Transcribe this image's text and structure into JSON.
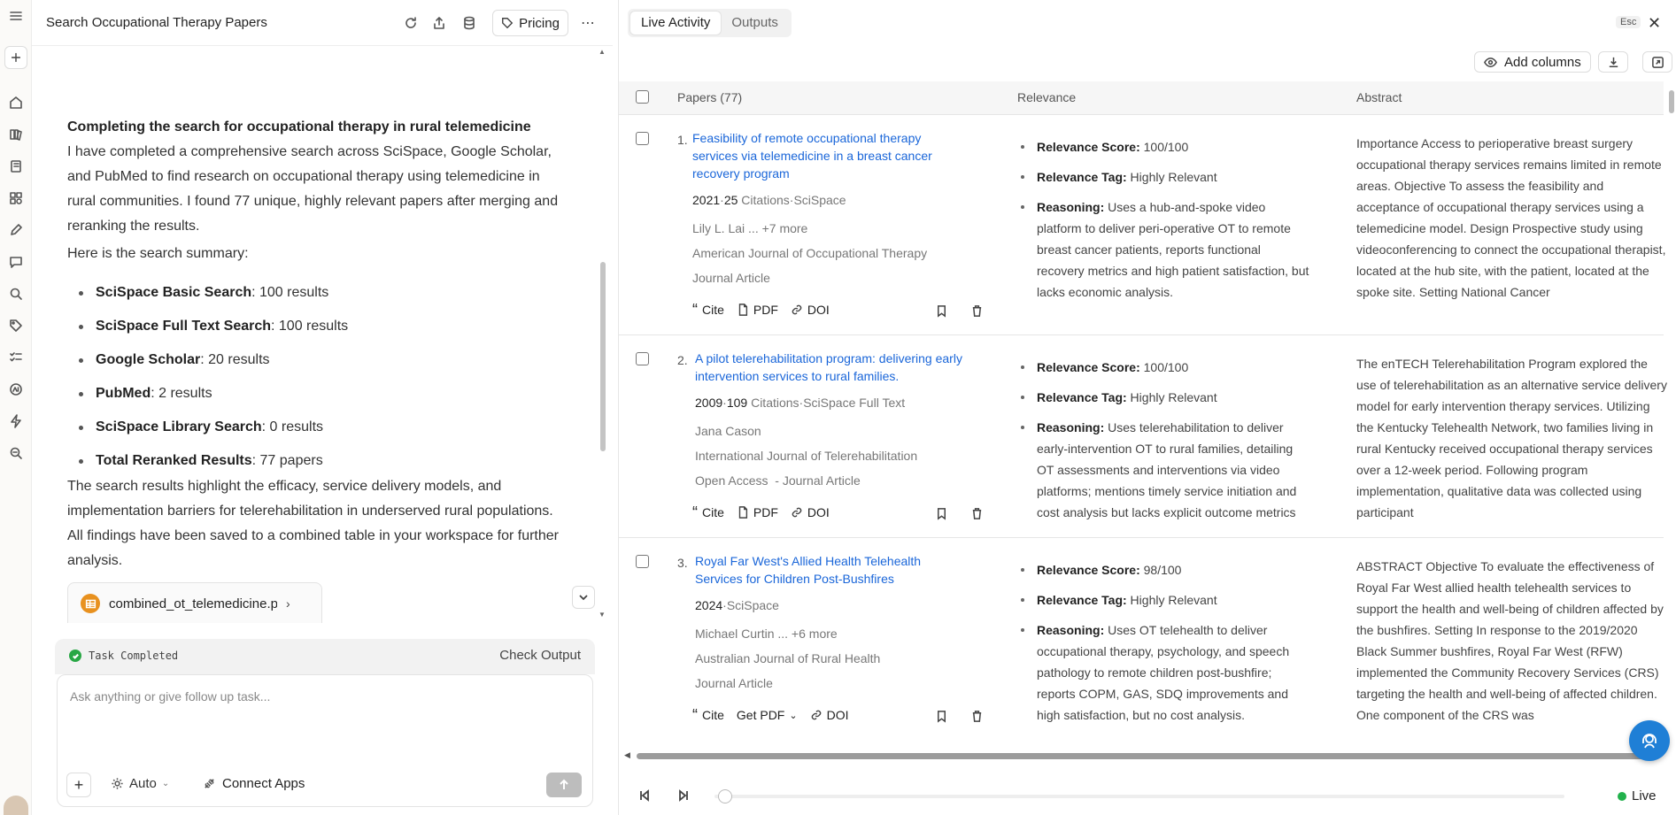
{
  "chat": {
    "title": "Search Occupational Therapy Papers",
    "pricing_label": "Pricing",
    "heading": "Completing the search for occupational therapy in rural telemedicine",
    "intro": "I have completed a comprehensive search across SciSpace, Google Scholar, and PubMed to find research on occupational therapy using telemedicine in rural communities. I found 77 unique, highly relevant papers after merging and reranking the results.",
    "summary_label": "Here is the search summary:",
    "summary_items": [
      {
        "name": "SciSpace Basic Search",
        "value": ": 100 results"
      },
      {
        "name": "SciSpace Full Text Search",
        "value": ": 100 results"
      },
      {
        "name": "Google Scholar",
        "value": ": 20 results"
      },
      {
        "name": "PubMed",
        "value": ": 2 results"
      },
      {
        "name": "SciSpace Library Search",
        "value": ": 0 results"
      },
      {
        "name": "Total Reranked Results",
        "value": ": 77 papers"
      }
    ],
    "conclusion": "The search results highlight the efficacy, service delivery models, and implementation barriers for telerehabilitation in underserved rural populations. All findings have been saved to a combined table in your workspace for further analysis.",
    "file_name": "combined_ot_telemedicine.p",
    "task_status": "Task Completed",
    "check_output": "Check Output",
    "input_placeholder": "Ask anything or give follow up task...",
    "mode": "Auto",
    "connect_apps": "Connect Apps"
  },
  "right": {
    "tabs": [
      {
        "label": "Live Activity",
        "active": true
      },
      {
        "label": "Outputs",
        "active": false
      }
    ],
    "esc_label": "Esc",
    "add_columns": "Add columns",
    "columns": {
      "papers": "Papers (77)",
      "relevance": "Relevance",
      "abstract": "Abstract"
    },
    "rows": [
      {
        "num": "1.",
        "title": "Feasibility of remote occupational therapy services via telemedicine in a breast cancer recovery program",
        "year": "2021",
        "citations": "25",
        "citations_label": "Citations",
        "source": "SciSpace",
        "authors": "Lily L. Lai ... +7 more",
        "journal": "American Journal of Occupational Therapy",
        "type": "Journal Article",
        "pdf_label": "PDF",
        "score_label": "Relevance Score:",
        "score": " 100/100",
        "tag_label": "Relevance Tag:",
        "tag": " Highly Relevant",
        "reason_label": "Reasoning:",
        "reason": " Uses a hub-and-spoke video platform to deliver peri-operative OT to remote breast cancer patients, reports functional recovery metrics and high patient satisfaction, but lacks economic analysis.",
        "abstract": "Importance Access to perioperative breast surgery occupational therapy services remains limited in remote areas. Objective To assess the feasibility and acceptance of occupational therapy services using a telemedicine model. Design Prospective study using videoconferencing to connect the occupational therapist, located at the hub site, with the patient, located at the spoke site. Setting National Cancer"
      },
      {
        "num": "2.",
        "title": "A pilot telerehabilitation program: delivering early intervention services to rural families.",
        "year": "2009",
        "citations": "109",
        "citations_label": "Citations",
        "source": "SciSpace Full Text",
        "authors": "Jana Cason",
        "journal": "International Journal of Telerehabilitation",
        "type": "Open Access  - Journal Article",
        "pdf_label": "PDF",
        "score_label": "Relevance Score:",
        "score": " 100/100",
        "tag_label": "Relevance Tag:",
        "tag": " Highly Relevant",
        "reason_label": "Reasoning:",
        "reason": " Uses telerehabilitation to deliver early-intervention OT to rural families, detailing OT assessments and interventions via video platforms; mentions timely service initiation and cost analysis but lacks explicit outcome metrics",
        "abstract": "The enTECH Telerehabilitation Program explored the use of telerehabilitation as an alternative service delivery model for early intervention therapy services. Utilizing the Kentucky Telehealth Network, two families living in rural Kentucky received occupational therapy services over a 12-week period. Following program implementation, qualitative data was collected using participant"
      },
      {
        "num": "3.",
        "title": "Royal Far West's Allied Health Telehealth Services for Children Post-Bushfires",
        "year": "2024",
        "citations": "",
        "citations_label": "",
        "source": "SciSpace",
        "authors": "Michael Curtin ... +6 more",
        "journal": "Australian Journal of Rural Health",
        "type": "Journal Article",
        "pdf_label": "Get PDF",
        "score_label": "Relevance Score:",
        "score": " 98/100",
        "tag_label": "Relevance Tag:",
        "tag": " Highly Relevant",
        "reason_label": "Reasoning:",
        "reason": " Uses OT telehealth to deliver occupational therapy, psychology, and speech pathology to remote children post-bushfire; reports COPM, GAS, SDQ improvements and high satisfaction, but no cost analysis.",
        "abstract": "ABSTRACT Objective To evaluate the effectiveness of Royal Far West allied health telehealth services to support the health and well-being of children affected by the bushfires. Setting In response to the 2019/2020 Black Summer bushfires, Royal Far West (RFW) implemented the Community Recovery Services (CRS) targeting the health and well-being of affected children. One component of the CRS was"
      }
    ],
    "cite_label": "Cite",
    "doi_label": "DOI",
    "live_label": "Live"
  },
  "colors": {
    "link": "#1a66d9",
    "live": "#22b14c",
    "fab": "#1f7fd6",
    "file_icon": "#e8911f"
  }
}
